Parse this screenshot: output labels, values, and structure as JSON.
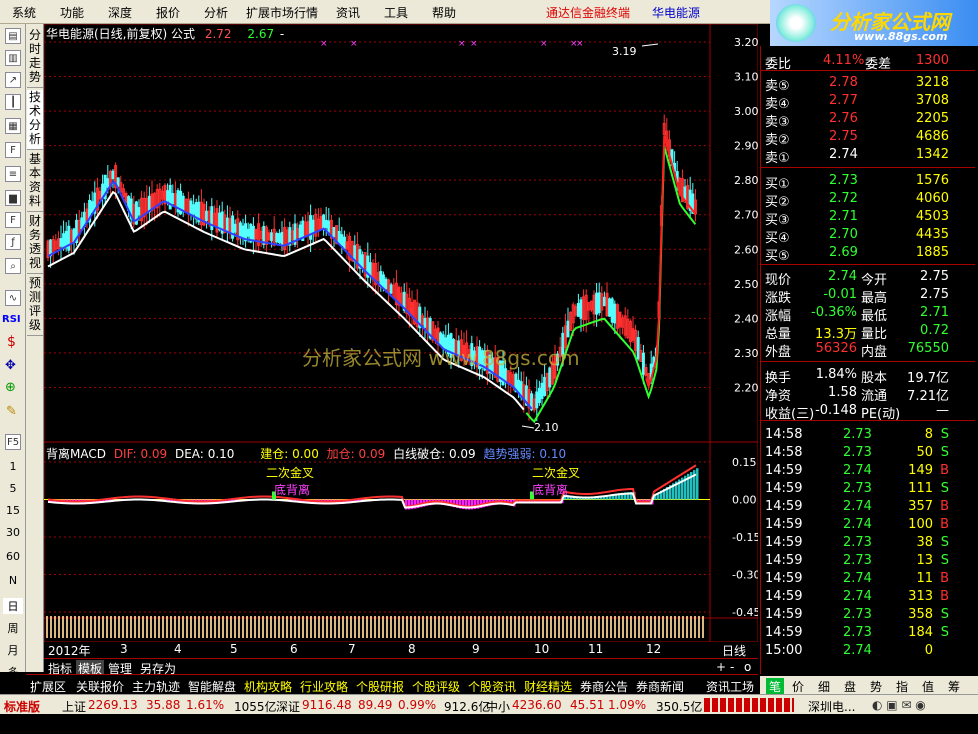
{
  "menu": {
    "items": [
      "系统",
      "功能",
      "深度",
      "报价",
      "分析",
      "扩展市场行情",
      "资讯",
      "工具",
      "帮助"
    ],
    "promo": "通达信金融终端",
    "stock": "华电能源"
  },
  "logo": {
    "title": "分析家公式网",
    "url": "www.88gs.com"
  },
  "left_toolbar": {
    "periods": [
      "1",
      "5",
      "15",
      "30",
      "60",
      "N",
      "日",
      "周",
      "月",
      "多"
    ],
    "icons": [
      "RSI"
    ]
  },
  "vtabs": [
    "分时走势",
    "技术分析",
    "基本资料",
    "财务透视",
    "预测评级"
  ],
  "main_chart": {
    "title": "华电能源(日线,前复权) 公式",
    "v1": "2.72",
    "v2": "2.67",
    "v3": "-",
    "price_axis": [
      "3.20",
      "3.10",
      "3.00",
      "2.90",
      "2.80",
      "2.70",
      "2.60",
      "2.50",
      "2.40",
      "2.30",
      "2.20"
    ],
    "high_label": "3.19",
    "low_label": "2.10",
    "watermark": "分析家公式网 www.88gs.com"
  },
  "chart_data": [
    {
      "type": "candlestick",
      "title": "华电能源(日线,前复权)",
      "x_months": [
        "2012年",
        "3",
        "4",
        "5",
        "6",
        "7",
        "8",
        "9",
        "10",
        "11",
        "12"
      ],
      "ylim": [
        2.1,
        3.2
      ],
      "high": 3.19,
      "low": 2.1
    },
    {
      "type": "macd",
      "title": "背离MACD",
      "dif": 0.09,
      "dea": 0.1,
      "ylim": [
        -0.45,
        0.15
      ],
      "ticks": [
        0.15,
        0.0,
        -0.15,
        -0.3,
        -0.45
      ],
      "annotations": [
        "二次金叉",
        "底背离",
        "二次金叉",
        "底背离"
      ]
    }
  ],
  "indicator": {
    "name": "背离MACD",
    "dif_label": "DIF:",
    "dif": "0.09",
    "dea_label": "DEA:",
    "dea": "0.10",
    "jc_label": "建仓:",
    "jc": "0.00",
    "add_label": "加仓:",
    "add": "0.09",
    "wb_label": "白线破仓:",
    "wb": "0.09",
    "trend_label": "趋势强弱:",
    "trend": "0.10",
    "axis": [
      "0.15",
      "0.00",
      "-0.15",
      "-0.30",
      "-0.45"
    ],
    "ann1": "二次金叉",
    "ann2": "底背离"
  },
  "time_axis": {
    "year": "2012年",
    "months": [
      "3",
      "4",
      "5",
      "6",
      "7",
      "8",
      "9",
      "10",
      "11",
      "12"
    ],
    "period": "日线"
  },
  "bottom_tabs": [
    "指标",
    "模板",
    "管理",
    "另存为"
  ],
  "func_tabs": [
    "扩展区",
    "关联报价",
    "主力轨迹",
    "智能解盘",
    "机构攻略",
    "行业攻略",
    "个股研报",
    "个股评级",
    "个股资讯",
    "财经精选",
    "券商公告",
    "券商新闻",
    "资讯工场"
  ],
  "status": {
    "edition": "标准版",
    "sh_label": "上证",
    "sh": "2269.13",
    "sh_chg": "35.88",
    "sh_pct": "1.61%",
    "sh_amt": "1055亿",
    "sz_label": "深证",
    "sz": "9116.48",
    "sz_chg": "89.49",
    "sz_pct": "0.99%",
    "sz_amt": "912.6亿",
    "zx_label": "中小",
    "zx": "4236.60",
    "zx_chg": "45.51",
    "zx_pct": "1.09%",
    "zx_amt": "350.5亿",
    "server": "深圳电..."
  },
  "quote": {
    "wb_label": "委比",
    "wb": "4.11%",
    "wc_label": "委差",
    "wc": "1300",
    "sell": [
      {
        "l": "卖⑤",
        "p": "2.78",
        "v": "3218"
      },
      {
        "l": "卖④",
        "p": "2.77",
        "v": "3708"
      },
      {
        "l": "卖③",
        "p": "2.76",
        "v": "2205"
      },
      {
        "l": "卖②",
        "p": "2.75",
        "v": "4686"
      },
      {
        "l": "卖①",
        "p": "2.74",
        "v": "1342"
      }
    ],
    "buy": [
      {
        "l": "买①",
        "p": "2.73",
        "v": "1576"
      },
      {
        "l": "买②",
        "p": "2.72",
        "v": "4060"
      },
      {
        "l": "买③",
        "p": "2.71",
        "v": "4503"
      },
      {
        "l": "买④",
        "p": "2.70",
        "v": "4435"
      },
      {
        "l": "买⑤",
        "p": "2.69",
        "v": "1885"
      }
    ],
    "stats": [
      {
        "a": "现价",
        "av": "2.74",
        "b": "今开",
        "bv": "2.75"
      },
      {
        "a": "涨跌",
        "av": "-0.01",
        "b": "最高",
        "bv": "2.75"
      },
      {
        "a": "涨幅",
        "av": "-0.36%",
        "b": "最低",
        "bv": "2.71"
      },
      {
        "a": "总量",
        "av": "13.3万",
        "b": "量比",
        "bv": "0.72"
      },
      {
        "a": "外盘",
        "av": "56326",
        "b": "内盘",
        "bv": "76550"
      }
    ],
    "stats2": [
      {
        "a": "换手",
        "av": "1.84%",
        "b": "股本",
        "bv": "19.7亿"
      },
      {
        "a": "净资",
        "av": "1.58",
        "b": "流通",
        "bv": "7.21亿"
      },
      {
        "a": "收益(三)",
        "av": "-0.148",
        "b": "PE(动)",
        "bv": "—"
      }
    ],
    "ticks": [
      {
        "t": "14:58",
        "p": "2.73",
        "v": "8",
        "s": "S"
      },
      {
        "t": "14:58",
        "p": "2.73",
        "v": "50",
        "s": "S"
      },
      {
        "t": "14:59",
        "p": "2.74",
        "v": "149",
        "s": "B"
      },
      {
        "t": "14:59",
        "p": "2.73",
        "v": "111",
        "s": "S"
      },
      {
        "t": "14:59",
        "p": "2.74",
        "v": "357",
        "s": "B"
      },
      {
        "t": "14:59",
        "p": "2.74",
        "v": "100",
        "s": "B"
      },
      {
        "t": "14:59",
        "p": "2.73",
        "v": "38",
        "s": "S"
      },
      {
        "t": "14:59",
        "p": "2.73",
        "v": "13",
        "s": "S"
      },
      {
        "t": "14:59",
        "p": "2.74",
        "v": "11",
        "s": "B"
      },
      {
        "t": "14:59",
        "p": "2.74",
        "v": "313",
        "s": "B"
      },
      {
        "t": "14:59",
        "p": "2.73",
        "v": "358",
        "s": "S"
      },
      {
        "t": "14:59",
        "p": "2.73",
        "v": "184",
        "s": "S"
      },
      {
        "t": "15:00",
        "p": "2.74",
        "v": "0",
        "s": ""
      }
    ]
  },
  "right_tabs": [
    "笔",
    "价",
    "细",
    "盘",
    "势",
    "指",
    "值",
    "筹"
  ],
  "colors": {
    "up": "#ff3030",
    "down": "#54ffff",
    "grid": "#a00000",
    "yellow": "#ffff00",
    "green": "#30ff30"
  }
}
